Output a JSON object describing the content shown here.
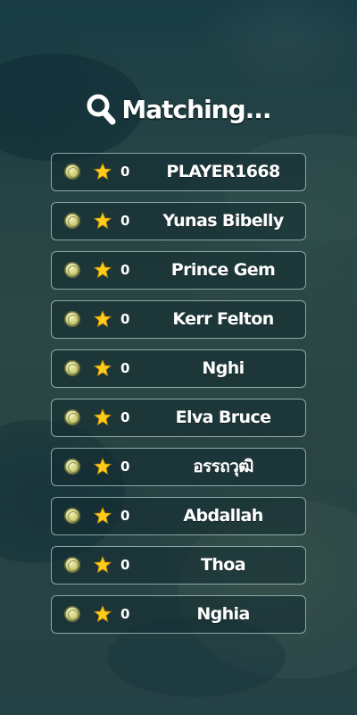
{
  "screen": {
    "title": "Matching...",
    "title_icon": "search-icon"
  },
  "players": [
    {
      "score": "0",
      "name": "PLAYER1668",
      "rank_icon": "medal-icon",
      "score_icon": "star-icon"
    },
    {
      "score": "0",
      "name": "Yunas Bibelly",
      "rank_icon": "medal-icon",
      "score_icon": "star-icon"
    },
    {
      "score": "0",
      "name": "Prince Gem",
      "rank_icon": "medal-icon",
      "score_icon": "star-icon"
    },
    {
      "score": "0",
      "name": "Kerr Felton",
      "rank_icon": "medal-icon",
      "score_icon": "star-icon"
    },
    {
      "score": "0",
      "name": "Nghi",
      "rank_icon": "medal-icon",
      "score_icon": "star-icon"
    },
    {
      "score": "0",
      "name": "Elva Bruce",
      "rank_icon": "medal-icon",
      "score_icon": "star-icon"
    },
    {
      "score": "0",
      "name": "อรรถวุฒิ",
      "rank_icon": "medal-icon",
      "score_icon": "star-icon"
    },
    {
      "score": "0",
      "name": "Abdallah",
      "rank_icon": "medal-icon",
      "score_icon": "star-icon"
    },
    {
      "score": "0",
      "name": "Thoa",
      "rank_icon": "medal-icon",
      "score_icon": "star-icon"
    },
    {
      "score": "0",
      "name": "Nghia",
      "rank_icon": "medal-icon",
      "score_icon": "star-icon"
    }
  ],
  "colors": {
    "text": "#ffffff",
    "star": "#ffcc1a",
    "medal": "#cfd27a",
    "row_border": "#b4cdcd"
  }
}
